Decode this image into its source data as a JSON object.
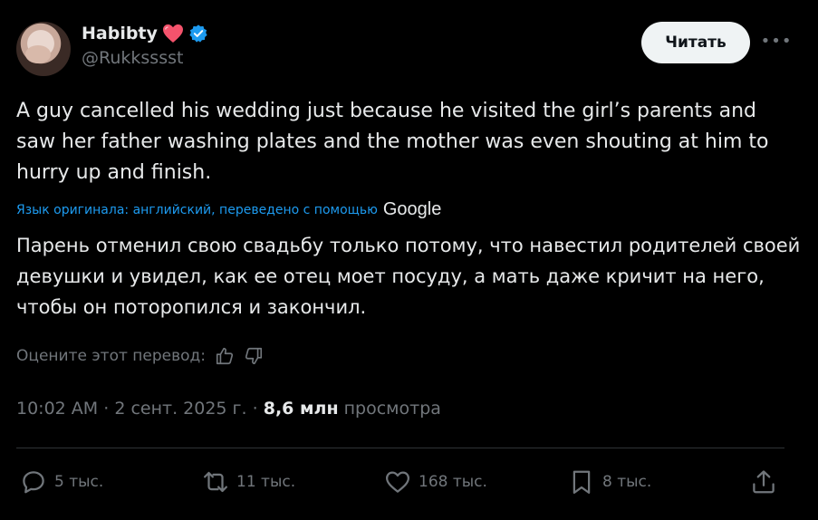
{
  "author": {
    "name": "Habibty",
    "handle": "@Rukksssst"
  },
  "header": {
    "read_label": "Читать",
    "more_label": "•••"
  },
  "tweet": {
    "text": "A guy cancelled his wedding just because he visited the girl’s parents and saw  her father washing plates and the mother was even shouting at him to hurry up and finish.",
    "translation_note": "Язык оригинала: английский, переведено с помощью",
    "translation_provider": "Google",
    "translation": "Парень отменил свою свадьбу только потому, что навестил родителей своей девушки и увидел, как ее отец моет посуду, а мать даже кричит на него, чтобы он поторопился и закончил.",
    "rate_prompt": "Оцените этот перевод:",
    "time": "10:02 AM",
    "date": "2 сент. 2025 г.",
    "views_count": "8,6 млн",
    "views_label": "просмотра"
  },
  "actions": {
    "replies": "5 тыс.",
    "reposts": "11 тыс.",
    "likes": "168 тыс.",
    "bookmarks": "8 тыс."
  },
  "colors": {
    "background": "#000000",
    "text": "#e7e9ea",
    "secondary": "#71767b",
    "link": "#1d9bf0",
    "verified": "#1d9bf0",
    "heart": "#f4536c"
  }
}
